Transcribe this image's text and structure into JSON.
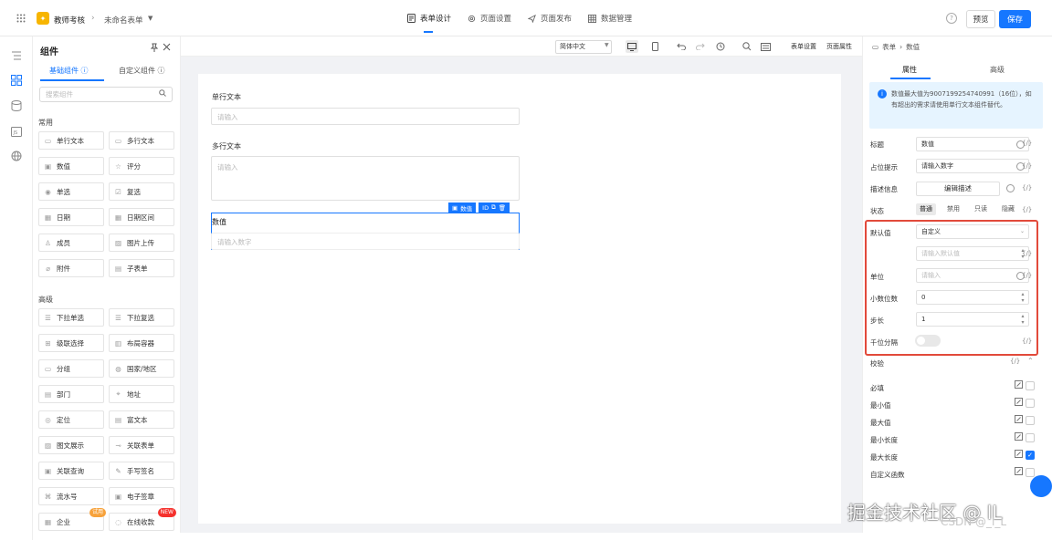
{
  "topbar": {
    "app_name": "教师考核",
    "form_name": "未命名表单",
    "tabs": [
      {
        "label": "表单设计",
        "icon": "form-icon"
      },
      {
        "label": "页面设置",
        "icon": "gear-icon"
      },
      {
        "label": "页面发布",
        "icon": "send-icon"
      },
      {
        "label": "数据管理",
        "icon": "table-icon"
      }
    ],
    "help": "?",
    "preview_label": "预览",
    "save_label": "保存"
  },
  "components": {
    "title": "组件",
    "tab_basic": "基础组件 ⓘ",
    "tab_custom": "自定义组件 ⓘ",
    "search_placeholder": "搜索组件",
    "group_common": "常用",
    "group_advanced": "高级",
    "common": [
      "单行文本",
      "多行文本",
      "数值",
      "评分",
      "单选",
      "复选",
      "日期",
      "日期区间",
      "成员",
      "图片上传",
      "附件",
      "子表单"
    ],
    "advanced": [
      "下拉单选",
      "下拉复选",
      "级联选择",
      "布局容器",
      "分组",
      "国家/地区",
      "部门",
      "地址",
      "定位",
      "富文本",
      "图文展示",
      "关联表单",
      "关联查询",
      "手写签名",
      "流水号",
      "电子签章",
      "企业",
      "在线收款"
    ],
    "badge_try": "试用",
    "badge_new": "NEW"
  },
  "toolbar": {
    "font_value": "简体中文",
    "form_settings": "表单设置",
    "page_attrs": "页面属性"
  },
  "canvas": {
    "field1_label": "单行文本",
    "field1_placeholder": "请输入",
    "field2_label": "多行文本",
    "field2_placeholder": "请输入",
    "field3_label": "数值",
    "field3_placeholder": "请输入数字",
    "selected_tag": "数值",
    "selected_id": "ID"
  },
  "props": {
    "breadcrumb_root": "表单",
    "breadcrumb_current": "数值",
    "tab_attr": "属性",
    "tab_style": "高级",
    "info": "数值最大值为9007199254740991（16位），如有超出的需求请使用单行文本组件替代。",
    "title_label": "标题",
    "title_value": "数值",
    "placeholder_label": "占位提示",
    "placeholder_value": "请输入数字",
    "desc_label": "描述信息",
    "desc_button": "编辑描述",
    "state_label": "状态",
    "states": [
      "普通",
      "禁用",
      "只读",
      "隐藏"
    ],
    "default_label": "默认值",
    "default_mode": "自定义",
    "default_placeholder": "请输入默认值",
    "unit_label": "单位",
    "unit_placeholder": "请输入",
    "decimals_label": "小数位数",
    "decimals_value": "0",
    "step_label": "步长",
    "step_value": "1",
    "thousands_label": "千位分隔",
    "validation_label": "校验",
    "fx": "{/}",
    "validations": [
      {
        "label": "必填",
        "checked": false
      },
      {
        "label": "最小值",
        "checked": false
      },
      {
        "label": "最大值",
        "checked": false
      },
      {
        "label": "最小长度",
        "checked": false
      },
      {
        "label": "最大长度",
        "checked": true
      },
      {
        "label": "自定义函数",
        "checked": false
      }
    ]
  },
  "watermark": {
    "line1": "掘金技术社区 @ lL",
    "line2": "CSDN @_l_L"
  },
  "colors": {
    "accent": "#1677ff",
    "highlight": "#e24a3b",
    "logo": "#f7b500"
  }
}
